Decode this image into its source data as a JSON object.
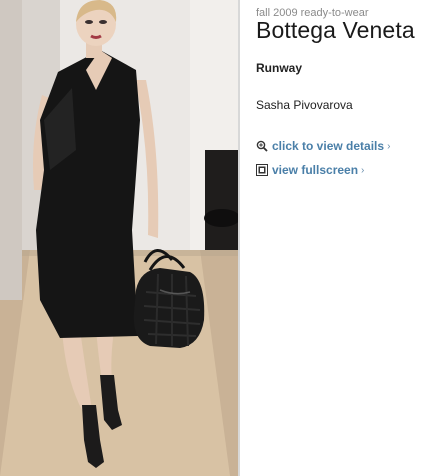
{
  "photo": {
    "subject": "runway model",
    "accessory": "black woven handbag"
  },
  "info": {
    "season": "fall 2009 ready-to-wear",
    "designer": "Bottega Veneta",
    "section": "Runway",
    "model_name": "Sasha Pivovarova"
  },
  "links": {
    "details_label": "click to view details",
    "fullscreen_label": "view fullscreen",
    "chevron": "›"
  },
  "icons": {
    "details": "zoom-in-icon",
    "fullscreen": "fullscreen-icon"
  },
  "colors": {
    "link": "#4a7fa8",
    "season_text": "#8a8a8a",
    "title_text": "#1a1a1a"
  }
}
